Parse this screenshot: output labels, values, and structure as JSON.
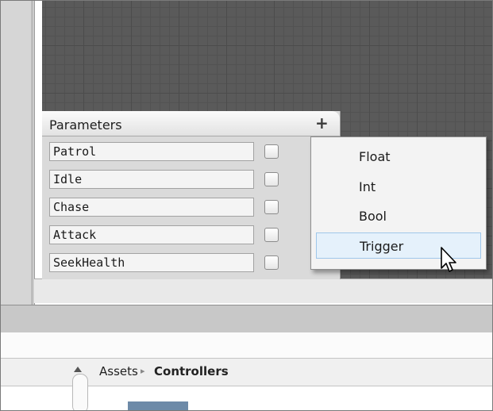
{
  "parameters_panel": {
    "title": "Parameters",
    "add_symbol": "+",
    "items": [
      {
        "name": "Patrol"
      },
      {
        "name": "Idle"
      },
      {
        "name": "Chase"
      },
      {
        "name": "Attack"
      },
      {
        "name": "SeekHealth"
      }
    ]
  },
  "add_menu": {
    "items": [
      {
        "label": "Float"
      },
      {
        "label": "Int"
      },
      {
        "label": "Bool"
      },
      {
        "label": "Trigger"
      }
    ],
    "highlighted": "Trigger"
  },
  "project_panel": {
    "breadcrumb": [
      {
        "label": "Assets"
      },
      {
        "label": "Controllers"
      }
    ],
    "separator": "▸"
  },
  "colors": {
    "grid_background": "#5a5a5a",
    "menu_highlight": "#e5f1fb",
    "menu_highlight_border": "#9fc7ea"
  }
}
